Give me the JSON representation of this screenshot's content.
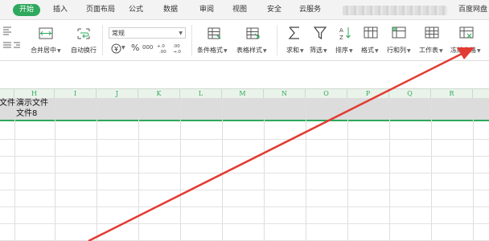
{
  "tabs": {
    "items": [
      "开始",
      "插入",
      "页面布局",
      "公式",
      "数据",
      "审阅",
      "视图",
      "安全",
      "云服务",
      "百度网盘"
    ],
    "active": "开始"
  },
  "ribbon": {
    "merge_label": "合并居中",
    "wrap_label": "自动换行",
    "number_format": "常规",
    "percent_symbol": "%",
    "thousands_symbol": "000",
    "increase_decimal": "+.0 .00",
    "decrease_decimal": ".00 →.0",
    "conditional_format_label": "条件格式",
    "table_style_label": "表格样式",
    "sum_label": "求和",
    "filter_label": "筛选",
    "sort_label": "排序",
    "format_label": "格式",
    "rows_cols_label": "行和列",
    "worksheet_label": "工作表",
    "freeze_label": "冻结窗格",
    "icons": {
      "merge": "merge-cells-icon",
      "wrap": "wrap-text-icon",
      "currency": "currency-icon",
      "cond": "conditional-format-icon",
      "table_style": "table-style-icon",
      "sum": "sigma-icon",
      "filter": "funnel-icon",
      "sort": "sort-az-icon",
      "format": "format-icon",
      "rows_cols": "rows-columns-icon",
      "worksheet": "worksheet-icon",
      "freeze": "freeze-panes-icon"
    }
  },
  "sheet": {
    "columns": [
      "H",
      "I",
      "J",
      "K",
      "L",
      "M",
      "N",
      "O",
      "P",
      "Q",
      "R"
    ],
    "cells": {
      "g1": "文件",
      "h1_line1": "演示文件",
      "h1_line2": "文件8"
    }
  },
  "colors": {
    "accent": "#2ea85c",
    "arrow": "#e23b33",
    "selected_row": "#dcdcdc"
  }
}
